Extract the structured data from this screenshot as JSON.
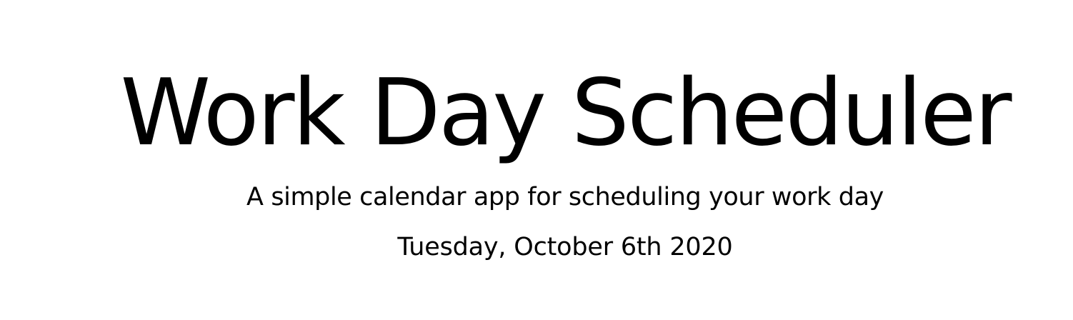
{
  "header": {
    "title": "Work Day Scheduler",
    "subtitle": "A simple calendar app for scheduling your work day",
    "current_day": "Tuesday, October 6th 2020"
  },
  "colors": {
    "background": "#ffffff",
    "text": "#000000"
  }
}
